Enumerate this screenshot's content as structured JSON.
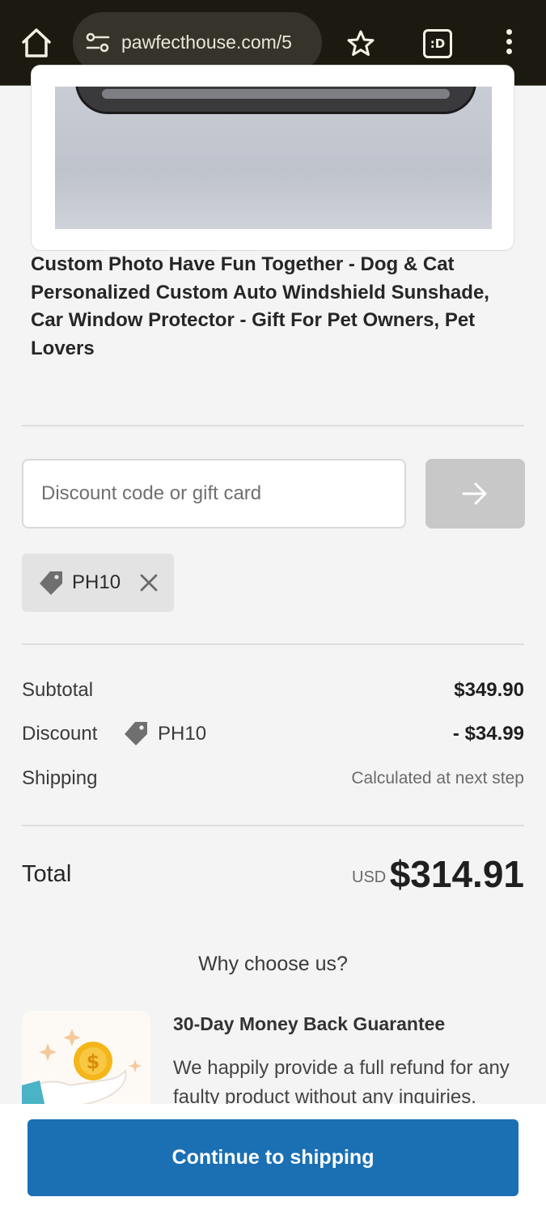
{
  "browser": {
    "url": "pawfecthouse.com/5",
    "tabs_label": ":D"
  },
  "product": {
    "title": "Custom Photo Have Fun Together - Dog & Cat Personalized Custom Auto Windshield Sunshade, Car Window Protector - Gift For Pet Owners, Pet Lovers"
  },
  "discount": {
    "placeholder": "Discount code or gift card",
    "applied_code": "PH10"
  },
  "summary": {
    "subtotal_label": "Subtotal",
    "subtotal_value": "$349.90",
    "discount_label": "Discount",
    "discount_code": "PH10",
    "discount_value": "- $34.99",
    "shipping_label": "Shipping",
    "shipping_value": "Calculated at next step",
    "total_label": "Total",
    "currency": "USD",
    "total_value": "$314.91"
  },
  "why": {
    "heading": "Why choose us?",
    "feature_title": "30-Day Money Back Guarantee",
    "feature_desc": "We happily provide a full refund for any faulty product without any inquiries."
  },
  "actions": {
    "continue_label": "Continue to shipping"
  },
  "colors": {
    "primary_button": "#1b6fb3",
    "browser_bar": "#1c1a10"
  }
}
